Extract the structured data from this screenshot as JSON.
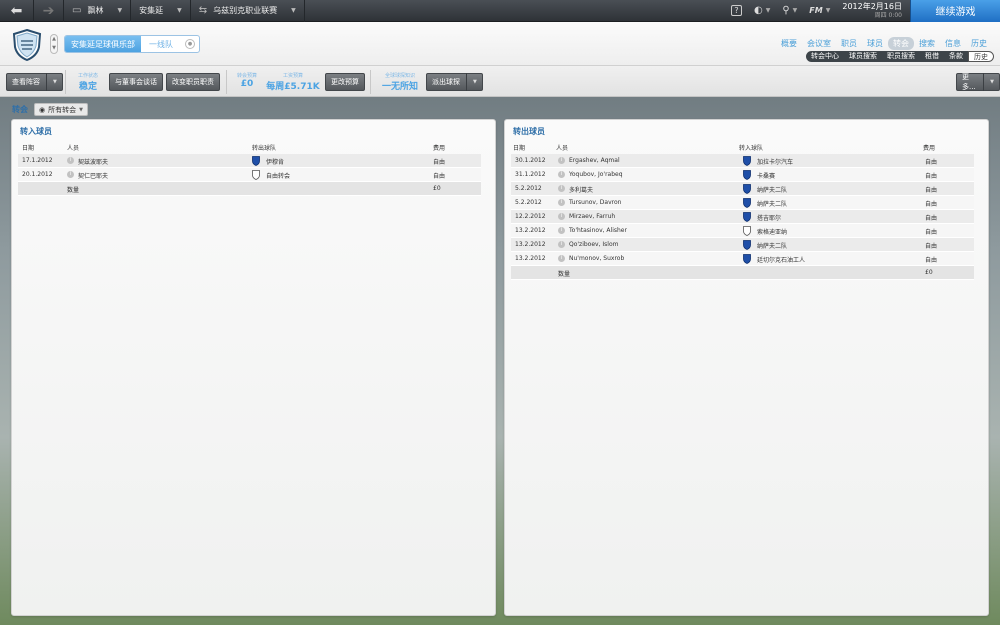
{
  "topbar": {
    "back_icon": "back-arrow-icon",
    "forward_icon": "forward-arrow-icon",
    "menus": [
      {
        "label": "飘林",
        "icon": "manager-card-icon"
      },
      {
        "label": "安集延",
        "icon": ""
      },
      {
        "label": "乌兹别克职业联赛",
        "icon": "transfer-arrows-icon"
      }
    ],
    "fm_label": "FM",
    "date": "2012年2月16日",
    "weekday": "周四 0:00",
    "continue_label": "继续游戏"
  },
  "header": {
    "club_name": "安集延足球俱乐部",
    "team_name": "一线队",
    "nav_main": [
      "概要",
      "会议室",
      "职员",
      "球员",
      "转会",
      "搜索",
      "信息",
      "历史"
    ],
    "nav_main_active": 4,
    "nav_sub": [
      "转会中心",
      "球员搜索",
      "职员搜索",
      "租借",
      "条款",
      "历史"
    ],
    "nav_sub_active": 5
  },
  "toolbar": {
    "view_squad": "查看阵容",
    "job_status_label": "工作状态",
    "job_status_value": "稳定",
    "talk_board": "与董事会谈话",
    "change_staff": "改变职员职责",
    "transfer_budget_label": "转会预算",
    "transfer_budget_value": "£0",
    "wage_budget_label": "工资预算",
    "wage_budget_value": "每周£5.71K",
    "change_budget": "更改预算",
    "scout_label": "全球球探知识",
    "scout_value": "一无所知",
    "send_scout": "派出球探",
    "more": "更多..."
  },
  "subhead": {
    "title": "转会",
    "filter": "所有转会"
  },
  "transfers_in": {
    "title": "转入球员",
    "columns": {
      "date": "日期",
      "person": "人员",
      "team": "转出球队",
      "fee": "费用"
    },
    "rows": [
      {
        "date": "17.1.2012",
        "person": "契兹波耶夫",
        "team": "伊穆肯",
        "fee": "自由",
        "crest": "blue"
      },
      {
        "date": "20.1.2012",
        "person": "契仁巴耶夫",
        "team": "自由转会",
        "fee": "自由",
        "crest": "empty"
      }
    ],
    "total_label": "数量",
    "total_fee": "£0"
  },
  "transfers_out": {
    "title": "转出球员",
    "columns": {
      "date": "日期",
      "person": "人员",
      "team": "转入球队",
      "fee": "费用"
    },
    "rows": [
      {
        "date": "30.1.2012",
        "person": "Ergashev, Aqmal",
        "team": "加拉卡尔汽车",
        "fee": "自由",
        "crest": "blue"
      },
      {
        "date": "31.1.2012",
        "person": "Yoqubov, Jo'rabeq",
        "team": "卡桑赛",
        "fee": "自由",
        "crest": "blue"
      },
      {
        "date": "5.2.2012",
        "person": "多利葛夫",
        "team": "纳萨夫二队",
        "fee": "自由",
        "crest": "blue"
      },
      {
        "date": "5.2.2012",
        "person": "Tursunov, Davron",
        "team": "纳萨夫二队",
        "fee": "自由",
        "crest": "blue"
      },
      {
        "date": "12.2.2012",
        "person": "Mirzaev, Farruh",
        "team": "搭吉耶尔",
        "fee": "自由",
        "crest": "blue"
      },
      {
        "date": "13.2.2012",
        "person": "To'htasinov, Alisher",
        "team": "索格迪亚纳",
        "fee": "自由",
        "crest": "empty"
      },
      {
        "date": "13.2.2012",
        "person": "Qo'ziboev, Islom",
        "team": "纳萨夫二队",
        "fee": "自由",
        "crest": "blue"
      },
      {
        "date": "13.2.2012",
        "person": "Nu'monov, Suxrob",
        "team": "廷切尔克石油工人",
        "fee": "自由",
        "crest": "blue"
      }
    ],
    "total_label": "数量",
    "total_fee": "£0"
  },
  "colors": {
    "accent": "#4aa0e0",
    "continue": "#1f6fc4",
    "crest_blue": "#1f4fa8"
  }
}
